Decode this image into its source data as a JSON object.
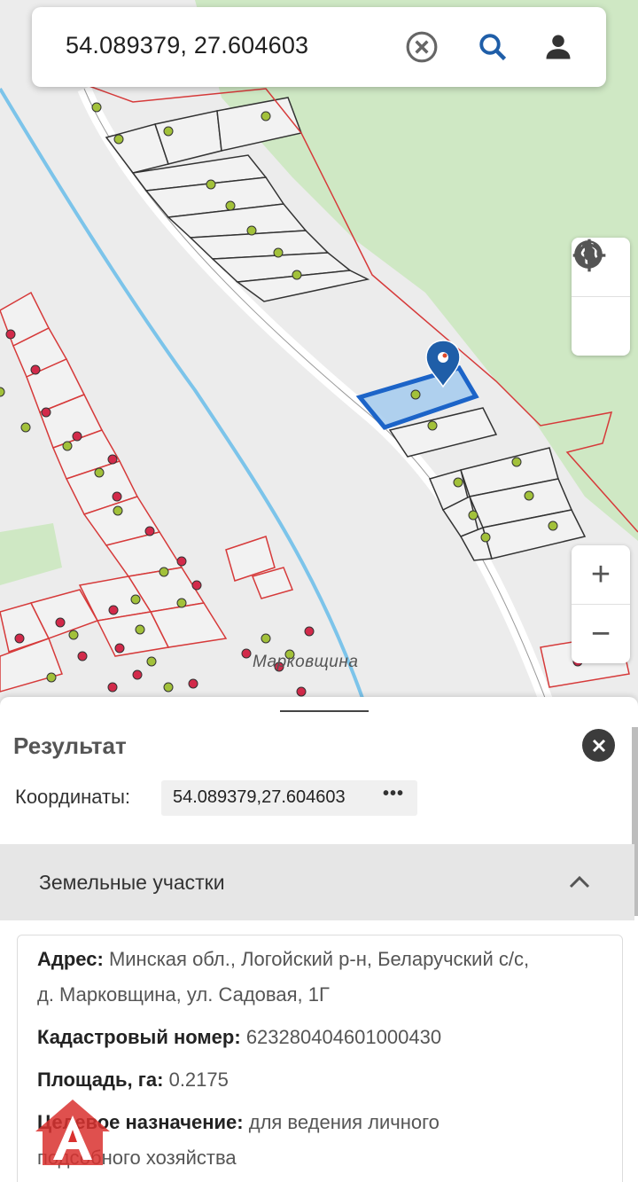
{
  "search": {
    "query": "54.089379, 27.604603",
    "clear_icon": "close-circle-icon",
    "search_icon": "search-icon",
    "user_icon": "user-icon"
  },
  "map": {
    "place_label": "Марковщина",
    "marker_icon": "location-pin-icon",
    "controls": {
      "layers_icon": "globe-icon",
      "locate_icon": "crosshair-icon",
      "zoom_in": "+",
      "zoom_out": "−"
    },
    "colors": {
      "parcel_border": "#d63a3a",
      "selected_fill": "#a9cdee",
      "selected_stroke": "#1c64c8",
      "forest": "#cfe8c4",
      "river": "#7cc4ea",
      "marker": "#1f5ea8"
    }
  },
  "result": {
    "title": "Результат",
    "coords_label": "Координаты:",
    "coords_value": "54.089379,27.604603",
    "coords_more": "•••",
    "section_title": "Земельные участки",
    "address_label": "Адрес:",
    "address_value": "Минская обл., Логойский р-н, Беларучский с/с,",
    "address_value_2": "д. Марковщина, ул. Садовая, 1Г",
    "cadastral_label": "Кадастровый номер:",
    "cadastral_value": "623280404601000430",
    "area_label": "Площадь, га:",
    "area_value": "0.2175",
    "purpose_label": "Целевое назначение:",
    "purpose_value": "для ведения личного",
    "purpose_value_2": "подсобного хозяйства"
  }
}
